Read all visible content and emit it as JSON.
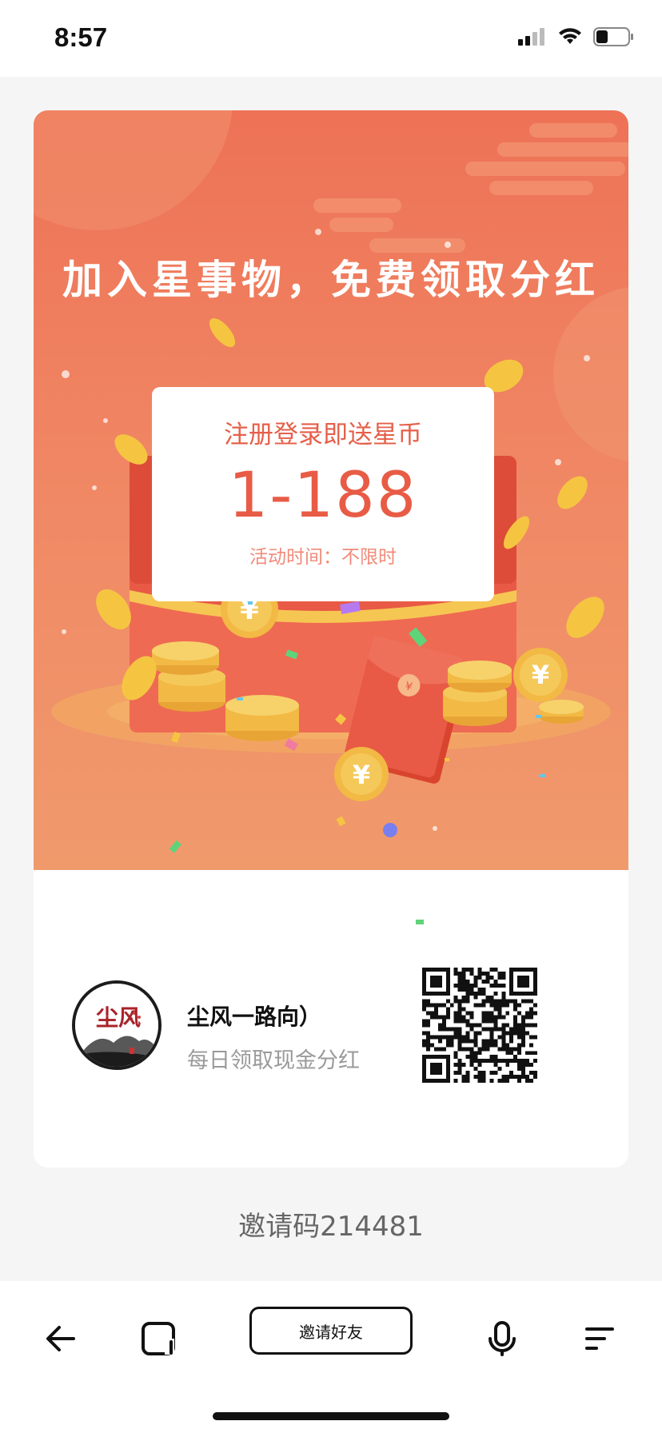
{
  "status_bar": {
    "time": "8:57",
    "icons": [
      "signal-icon",
      "wifi-icon",
      "battery-icon"
    ]
  },
  "banner": {
    "headline": "加入星事物，免费领取分红",
    "ticket_subtitle": "注册登录即送星币",
    "ticket_amount": "1-188",
    "ticket_time": "活动时间：不限时",
    "colors": {
      "background": "#ee7256",
      "coin": "#f5c542",
      "envelope": "#e85a45"
    }
  },
  "profile": {
    "avatar_text": "尘风",
    "name": "尘风一路向）",
    "tagline": "每日领取现金分红"
  },
  "invite_code": "邀请码214481",
  "bottom_bar": {
    "back": "back-arrow-icon",
    "tabs": "tabs-icon",
    "invite_button": "邀请好友",
    "voice": "microphone-icon",
    "menu": "menu-icon"
  }
}
